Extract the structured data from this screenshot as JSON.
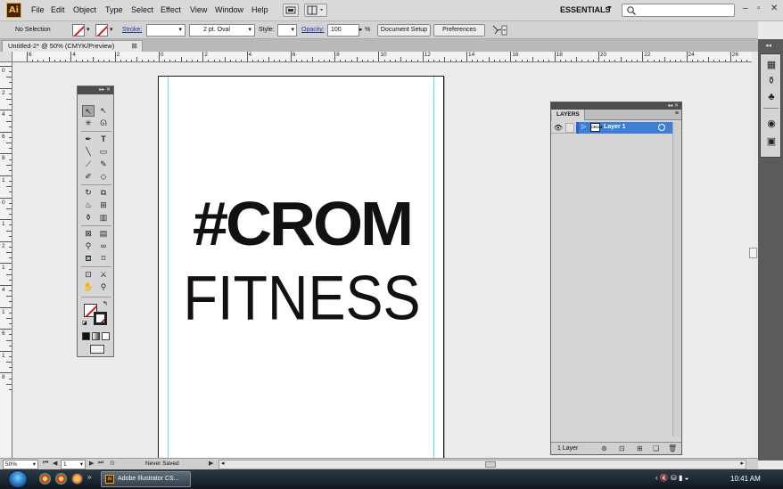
{
  "app": {
    "logo": "Ai",
    "title": "Adobe Illustrator CS..."
  },
  "menu": [
    "File",
    "Edit",
    "Object",
    "Type",
    "Select",
    "Effect",
    "View",
    "Window",
    "Help"
  ],
  "workspace": {
    "label": "ESSENTIALS"
  },
  "search": {
    "placeholder": ""
  },
  "control_bar": {
    "selection": "No Selection",
    "stroke_label": "Stroke:",
    "brush_label": "2 pt. Oval",
    "style_label": "Style:",
    "opacity_label": "Opacity:",
    "opacity_value": "100",
    "opacity_unit": "%",
    "doc_setup": "Document Setup",
    "preferences": "Preferences"
  },
  "document_tab": {
    "title": "Untitled-2* @ 50% (CMYK/Preview)",
    "close": "⊠"
  },
  "artwork": {
    "line1": "#CROM",
    "line2": "FITNESS"
  },
  "layers_panel": {
    "tab": "LAYERS",
    "layers": [
      {
        "name": "Layer 1",
        "thumb_text": "CROM"
      }
    ],
    "count": "1 Layer"
  },
  "status_bar": {
    "zoom": "50%",
    "page": "1",
    "status": "Never Saved"
  },
  "taskbar": {
    "task_label": "Adobe Illustrator CS...",
    "clock": "10:41 AM"
  },
  "rulers": {
    "h": [
      "6",
      "4",
      "2",
      "0",
      "2",
      "4",
      "6",
      "8",
      "10",
      "12",
      "14",
      "16",
      "18",
      "20",
      "22",
      "24",
      "26"
    ],
    "v": [
      "0",
      "2",
      "4",
      "6",
      "8",
      "1",
      "0",
      "1",
      "2",
      "1",
      "4",
      "1",
      "6",
      "1",
      "8"
    ]
  },
  "colors": {
    "accent": "#3d7fd8",
    "guide": "#5ee3ee",
    "none_slash": "#d21a1a"
  },
  "icons": [
    "selection-tool-icon",
    "direct-selection-tool-icon",
    "type-tool-icon",
    "pen-tool-icon",
    "zoom-tool-icon",
    "hand-tool-icon",
    "eye-icon",
    "new-layer-icon",
    "trash-icon"
  ]
}
